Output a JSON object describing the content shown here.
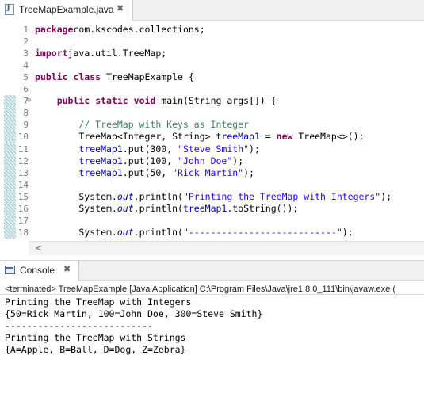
{
  "editor_tab": {
    "title": "TreeMapExample.java",
    "close": "✖",
    "icon": "J"
  },
  "code": {
    "lines": [
      {
        "n": "1",
        "segs": [
          [
            "kw",
            "package"
          ],
          [
            "",
            "com.kscodes.collections;"
          ]
        ]
      },
      {
        "n": "2",
        "segs": []
      },
      {
        "n": "3",
        "segs": [
          [
            "kw",
            "import"
          ],
          [
            "",
            "java.util.TreeMap;"
          ]
        ]
      },
      {
        "n": "4",
        "segs": []
      },
      {
        "n": "5",
        "segs": [
          [
            "kw",
            "public"
          ],
          [
            "",
            " "
          ],
          [
            "kw",
            "class"
          ],
          [
            "",
            " TreeMapExample {"
          ]
        ]
      },
      {
        "n": "6",
        "segs": []
      },
      {
        "n": "7",
        "segs": [
          [
            "",
            "    "
          ],
          [
            "kw",
            "public"
          ],
          [
            "",
            " "
          ],
          [
            "kw",
            "static"
          ],
          [
            "",
            " "
          ],
          [
            "kw",
            "void"
          ],
          [
            "",
            " main(String args[]) {"
          ]
        ]
      },
      {
        "n": "8",
        "segs": []
      },
      {
        "n": "9",
        "segs": [
          [
            "",
            "        "
          ],
          [
            "com",
            "// TreeMap with Keys as Integer"
          ]
        ]
      },
      {
        "n": "10",
        "segs": [
          [
            "",
            "        TreeMap<Integer, String> "
          ],
          [
            "fld",
            "treeMap1"
          ],
          [
            "",
            " = "
          ],
          [
            "kw",
            "new"
          ],
          [
            "",
            " TreeMap<>();"
          ]
        ]
      },
      {
        "n": "11",
        "segs": [
          [
            "",
            "        "
          ],
          [
            "fld",
            "treeMap1"
          ],
          [
            "",
            ".put(300, "
          ],
          [
            "str",
            "\"Steve Smith\""
          ],
          [
            "",
            ");"
          ]
        ]
      },
      {
        "n": "12",
        "segs": [
          [
            "",
            "        "
          ],
          [
            "fld",
            "treeMap1"
          ],
          [
            "",
            ".put(100, "
          ],
          [
            "str",
            "\"John Doe\""
          ],
          [
            "",
            ");"
          ]
        ]
      },
      {
        "n": "13",
        "segs": [
          [
            "",
            "        "
          ],
          [
            "fld",
            "treeMap1"
          ],
          [
            "",
            ".put(50, "
          ],
          [
            "str",
            "\"Rick Martin\""
          ],
          [
            "",
            ");"
          ]
        ]
      },
      {
        "n": "14",
        "segs": []
      },
      {
        "n": "15",
        "segs": [
          [
            "",
            "        System."
          ],
          [
            "st",
            "out"
          ],
          [
            "",
            ".println("
          ],
          [
            "str",
            "\"Printing the TreeMap with Integers\""
          ],
          [
            "",
            ");"
          ]
        ]
      },
      {
        "n": "16",
        "segs": [
          [
            "",
            "        System."
          ],
          [
            "st",
            "out"
          ],
          [
            "",
            ".println("
          ],
          [
            "fld",
            "treeMap1"
          ],
          [
            "",
            ".toString());"
          ]
        ]
      },
      {
        "n": "17",
        "segs": []
      },
      {
        "n": "18",
        "segs": [
          [
            "",
            "        System."
          ],
          [
            "st",
            "out"
          ],
          [
            "",
            ".println("
          ],
          [
            "str",
            "\"---------------------------\""
          ],
          [
            "",
            ");"
          ]
        ]
      }
    ]
  },
  "console_tab": {
    "title": "Console",
    "close": "✖"
  },
  "console": {
    "status": "<terminated> TreeMapExample [Java Application] C:\\Program Files\\Java\\jre1.8.0_111\\bin\\javaw.exe (",
    "output": [
      "Printing the TreeMap with Integers",
      "{50=Rick Martin, 100=John Doe, 300=Steve Smith}",
      "---------------------------",
      "Printing the TreeMap with Strings",
      "{A=Apple, B=Ball, D=Dog, Z=Zebra}"
    ]
  }
}
